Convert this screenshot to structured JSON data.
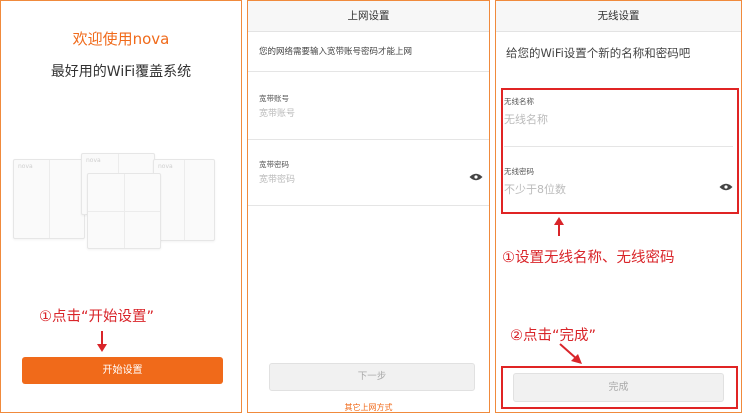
{
  "welcome": {
    "title": "欢迎使用nova",
    "subtitle": "最好用的WiFi覆盖系统",
    "device_logo": "nova",
    "annotation": "①点击“开始设置”",
    "start_button": "开始设置",
    "accent": "#f06a1a"
  },
  "internet": {
    "header": "上网设置",
    "description": "您的网络需要输入宽带账号密码才能上网",
    "account_label": "宽带账号",
    "account_placeholder": "宽带账号",
    "password_label": "宽带密码",
    "password_placeholder": "宽带密码",
    "next_button": "下一步",
    "other_link": "其它上网方式"
  },
  "wireless": {
    "header": "无线设置",
    "description": "给您的WiFi设置个新的名称和密码吧",
    "name_label": "无线名称",
    "name_placeholder": "无线名称",
    "password_label": "无线密码",
    "password_placeholder": "不少于8位数",
    "annotation1": "①设置无线名称、无线密码",
    "annotation2": "②点击“完成”",
    "done_button": "完成",
    "highlight": "#e02424"
  }
}
